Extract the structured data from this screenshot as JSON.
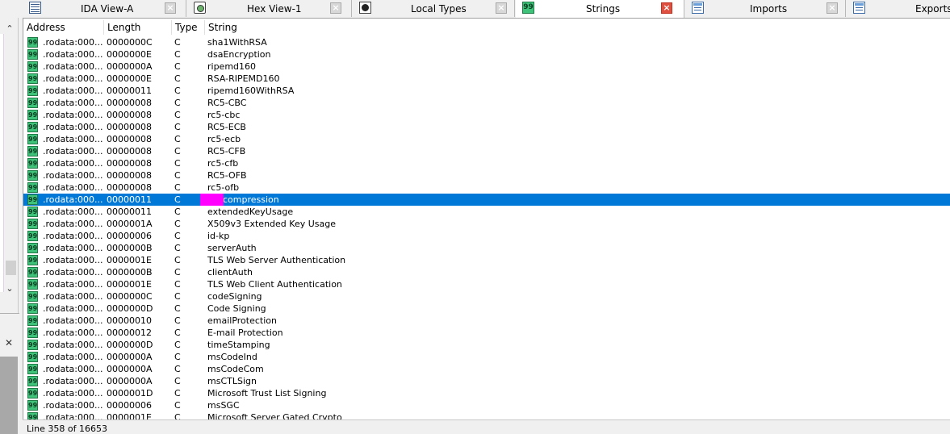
{
  "tabs": [
    {
      "label": "IDA View-A",
      "icon": "grid-view-icon",
      "active": false,
      "closable": true
    },
    {
      "label": "Hex View-1",
      "icon": "hex-view-icon",
      "active": false,
      "closable": true
    },
    {
      "label": "Local Types",
      "icon": "info-icon",
      "active": false,
      "closable": true
    },
    {
      "label": "Strings",
      "icon": "strings-icon",
      "active": true,
      "closable": true
    },
    {
      "label": "Imports",
      "icon": "imports-icon",
      "active": false,
      "closable": true
    },
    {
      "label": "Exports",
      "icon": "exports-icon",
      "active": false,
      "closable": false
    }
  ],
  "strings_icon_glyph": "99",
  "columns": [
    "Address",
    "Length",
    "Type",
    "String"
  ],
  "rows": [
    {
      "address": ".rodata:000...",
      "length": "0000000C",
      "type": "C",
      "string": "sha1WithRSA"
    },
    {
      "address": ".rodata:000...",
      "length": "0000000E",
      "type": "C",
      "string": "dsaEncryption"
    },
    {
      "address": ".rodata:000...",
      "length": "0000000A",
      "type": "C",
      "string": "ripemd160"
    },
    {
      "address": ".rodata:000...",
      "length": "0000000E",
      "type": "C",
      "string": "RSA-RIPEMD160"
    },
    {
      "address": ".rodata:000...",
      "length": "00000011",
      "type": "C",
      "string": "ripemd160WithRSA"
    },
    {
      "address": ".rodata:000...",
      "length": "00000008",
      "type": "C",
      "string": "RC5-CBC"
    },
    {
      "address": ".rodata:000...",
      "length": "00000008",
      "type": "C",
      "string": "rc5-cbc"
    },
    {
      "address": ".rodata:000...",
      "length": "00000008",
      "type": "C",
      "string": "RC5-ECB"
    },
    {
      "address": ".rodata:000...",
      "length": "00000008",
      "type": "C",
      "string": "rc5-ecb"
    },
    {
      "address": ".rodata:000...",
      "length": "00000008",
      "type": "C",
      "string": "RC5-CFB"
    },
    {
      "address": ".rodata:000...",
      "length": "00000008",
      "type": "C",
      "string": "rc5-cfb"
    },
    {
      "address": ".rodata:000...",
      "length": "00000008",
      "type": "C",
      "string": "RC5-OFB"
    },
    {
      "address": ".rodata:000...",
      "length": "00000008",
      "type": "C",
      "string": "rc5-ofb"
    },
    {
      "address": ".rodata:000...",
      "length": "00000011",
      "type": "C",
      "string": "compression",
      "selected": true,
      "redacted_prefix": true
    },
    {
      "address": ".rodata:000...",
      "length": "00000011",
      "type": "C",
      "string": "extendedKeyUsage"
    },
    {
      "address": ".rodata:000...",
      "length": "0000001A",
      "type": "C",
      "string": "X509v3 Extended Key Usage"
    },
    {
      "address": ".rodata:000...",
      "length": "00000006",
      "type": "C",
      "string": "id-kp"
    },
    {
      "address": ".rodata:000...",
      "length": "0000000B",
      "type": "C",
      "string": "serverAuth"
    },
    {
      "address": ".rodata:000...",
      "length": "0000001E",
      "type": "C",
      "string": "TLS Web Server Authentication"
    },
    {
      "address": ".rodata:000...",
      "length": "0000000B",
      "type": "C",
      "string": "clientAuth"
    },
    {
      "address": ".rodata:000...",
      "length": "0000001E",
      "type": "C",
      "string": "TLS Web Client Authentication"
    },
    {
      "address": ".rodata:000...",
      "length": "0000000C",
      "type": "C",
      "string": "codeSigning"
    },
    {
      "address": ".rodata:000...",
      "length": "0000000D",
      "type": "C",
      "string": "Code Signing"
    },
    {
      "address": ".rodata:000...",
      "length": "00000010",
      "type": "C",
      "string": "emailProtection"
    },
    {
      "address": ".rodata:000...",
      "length": "00000012",
      "type": "C",
      "string": "E-mail Protection"
    },
    {
      "address": ".rodata:000...",
      "length": "0000000D",
      "type": "C",
      "string": "timeStamping"
    },
    {
      "address": ".rodata:000...",
      "length": "0000000A",
      "type": "C",
      "string": "msCodeInd"
    },
    {
      "address": ".rodata:000...",
      "length": "0000000A",
      "type": "C",
      "string": "msCodeCom"
    },
    {
      "address": ".rodata:000...",
      "length": "0000000A",
      "type": "C",
      "string": "msCTLSign"
    },
    {
      "address": ".rodata:000...",
      "length": "0000001D",
      "type": "C",
      "string": "Microsoft Trust List Signing"
    },
    {
      "address": ".rodata:000...",
      "length": "00000006",
      "type": "C",
      "string": "msSGC"
    },
    {
      "address": ".rodata:000...",
      "length": "0000001E",
      "type": "C",
      "string": "Microsoft Server Gated Crypto"
    }
  ],
  "status": "Line 358 of 16653",
  "colors": {
    "selection": "#0078d7",
    "redaction": "#ff00ff",
    "string_icon": "#3fc27a"
  }
}
